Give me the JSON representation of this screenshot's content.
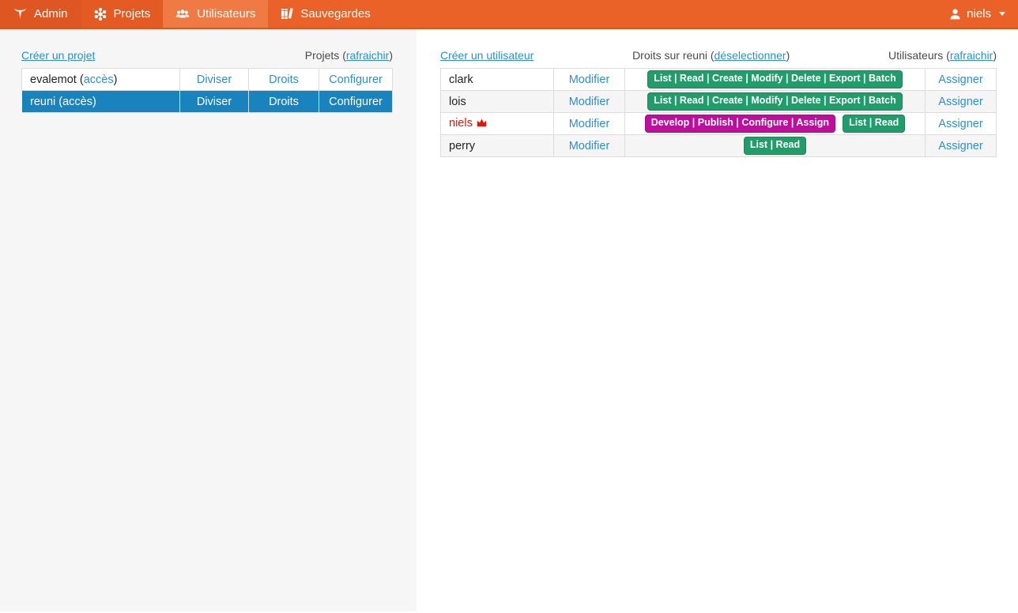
{
  "colors": {
    "navbar_bg": "#eb6228",
    "navbar_brand_bg": "#de5621",
    "navbar_projets_bg": "#e35b23",
    "navbar_active_bg": "#ef7a43",
    "navbar_border": "#d8571f",
    "link_blue": "#2b8fd2",
    "selected_row_bg": "#1983bd",
    "badge_green": "#1f9d6a",
    "badge_green_border": "#15875a",
    "badge_magenta": "#bf0d9e",
    "badge_magenta_border": "#a30b86",
    "admin_red": "#e81309",
    "muted_text": "#4a4a4a",
    "table_border": "#dddddd",
    "left_panel_bg": "#f6f6f7",
    "stripe_bg": "#f5f5f5"
  },
  "navbar": {
    "brand_label": "Admin",
    "items": [
      {
        "label": "Projets",
        "icon": "network-nodes-icon"
      },
      {
        "label": "Utilisateurs",
        "icon": "users-icon",
        "active": true
      },
      {
        "label": "Sauvegardes",
        "icon": "books-icon"
      }
    ],
    "user_name": "niels"
  },
  "projects": {
    "create_link": "Créer un projet",
    "header_prefix": "Projets (",
    "refresh_link": "rafraichir",
    "header_suffix": ")",
    "rows": [
      {
        "name_prefix": "evalemot (",
        "access_label": "accès",
        "name_suffix": ")",
        "actions": [
          "Diviser",
          "Droits",
          "Configurer"
        ],
        "selected": false
      },
      {
        "name_prefix": "reuni (",
        "access_label": "accès",
        "name_suffix": ")",
        "actions": [
          "Diviser",
          "Droits",
          "Configurer"
        ],
        "selected": true
      }
    ]
  },
  "users": {
    "create_link": "Créer un utilisateur",
    "rights_header_prefix": "Droits sur reuni (",
    "deselect_link": "déselectionner",
    "rights_header_suffix": ")",
    "users_header_prefix": "Utilisateurs (",
    "refresh_link": "rafraichir",
    "users_header_suffix": ")",
    "rows": [
      {
        "name": "clark",
        "modify_label": "Modifier",
        "assign_label": "Assigner",
        "badges": [
          {
            "text": "List | Read | Create | Modify | Delete | Export | Batch",
            "color": "green"
          }
        ]
      },
      {
        "name": "lois",
        "modify_label": "Modifier",
        "assign_label": "Assigner",
        "badges": [
          {
            "text": "List | Read | Create | Modify | Delete | Export | Batch",
            "color": "green"
          }
        ]
      },
      {
        "name": "niels",
        "is_admin": true,
        "modify_label": "Modifier",
        "assign_label": "Assigner",
        "badges": [
          {
            "text": "Develop | Publish | Configure | Assign",
            "color": "magenta"
          },
          {
            "text": "List | Read",
            "color": "green"
          }
        ]
      },
      {
        "name": "perry",
        "modify_label": "Modifier",
        "assign_label": "Assigner",
        "badges": [
          {
            "text": "List | Read",
            "color": "green"
          }
        ]
      }
    ]
  }
}
